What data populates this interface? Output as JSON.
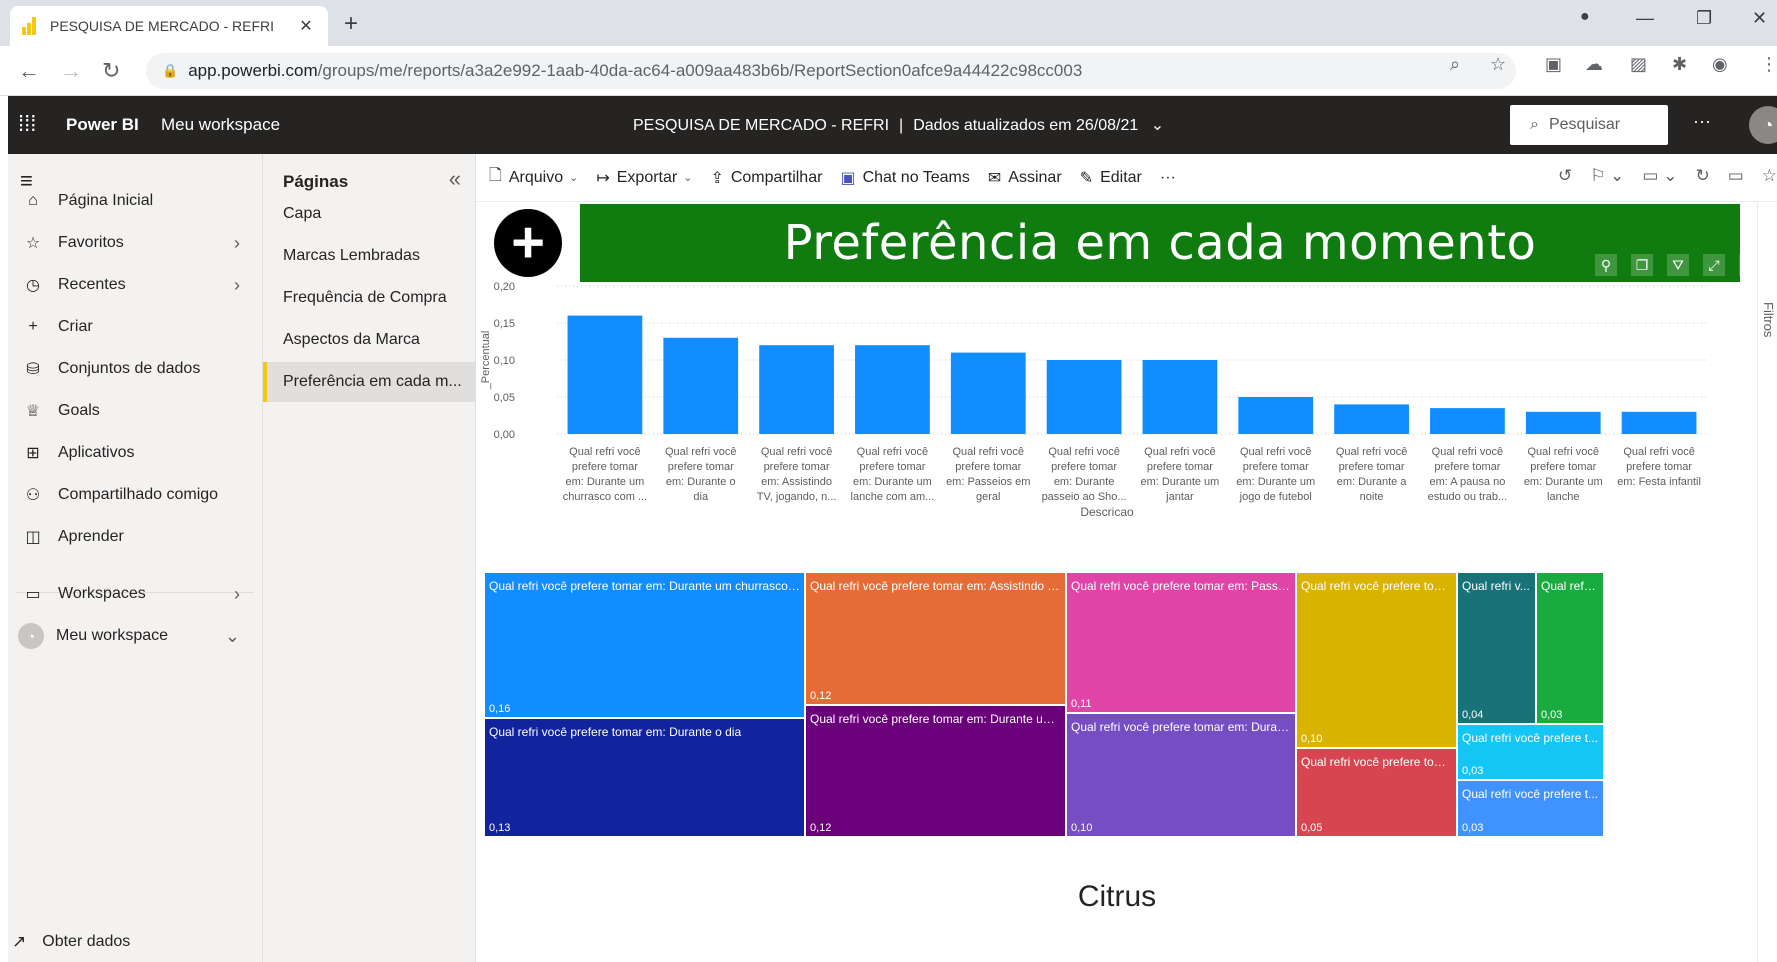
{
  "browser": {
    "tab_title": "PESQUISA DE MERCADO - REFRI",
    "tab_close": "✕",
    "new_tab": "+",
    "url_host": "app.powerbi.com",
    "url_path": "/groups/me/reports/a3a2e992-1aab-40da-ac64-a009aa483b6b/ReportSection0afce9a44422c98cc003",
    "window_controls": [
      "—",
      "❐",
      "✕"
    ]
  },
  "header": {
    "brand": "Power BI",
    "workspace": "Meu workspace",
    "report_title": "PESQUISA DE MERCADO - REFRI",
    "separator": "|",
    "updated": "Dados atualizados em 26/08/21",
    "search_placeholder": "Pesquisar",
    "more": "···"
  },
  "leftnav": {
    "items": [
      {
        "label": "Página Inicial",
        "icon": "home-icon"
      },
      {
        "label": "Favoritos",
        "icon": "star-icon"
      },
      {
        "label": "Recentes",
        "icon": "clock-icon"
      },
      {
        "label": "Criar",
        "icon": "plus-icon"
      },
      {
        "label": "Conjuntos de dados",
        "icon": "database-icon"
      },
      {
        "label": "Goals",
        "icon": "trophy-icon"
      },
      {
        "label": "Aplicativos",
        "icon": "apps-icon"
      },
      {
        "label": "Compartilhado comigo",
        "icon": "shared-icon"
      },
      {
        "label": "Aprender",
        "icon": "book-icon"
      }
    ],
    "workspaces": "Workspaces",
    "my_workspace": "Meu workspace",
    "get_data": "Obter dados"
  },
  "pages": {
    "heading": "Páginas",
    "items": [
      "Capa",
      "Marcas Lembradas",
      "Frequência de Compra",
      "Aspectos da Marca",
      "Preferência em cada m..."
    ],
    "active_index": 4
  },
  "actions": {
    "file": "Arquivo",
    "export": "Exportar",
    "share": "Compartilhar",
    "teams": "Chat no Teams",
    "subscribe": "Assinar",
    "edit": "Editar",
    "more": "···"
  },
  "report": {
    "banner_title": "Preferência em cada momento",
    "treemap_footer": "Citrus"
  },
  "filters": {
    "label": "Filtros"
  },
  "chart_data": {
    "type": "bar",
    "xlabel": "Descricao",
    "ylabel": "_Percentual",
    "ylim": [
      0,
      0.2
    ],
    "yticks": [
      "0,20",
      "0,15",
      "0,10",
      "0,05",
      "0,00"
    ],
    "grid": true,
    "categories": [
      [
        "Qual refri você",
        "prefere tomar",
        "em: Durante um",
        "churrasco com ..."
      ],
      [
        "Qual refri você",
        "prefere tomar",
        "em: Durante o",
        "dia"
      ],
      [
        "Qual refri você",
        "prefere tomar",
        "em: Assistindo",
        "TV, jogando, n..."
      ],
      [
        "Qual refri você",
        "prefere tomar",
        "em: Durante um",
        "lanche com am..."
      ],
      [
        "Qual refri você",
        "prefere tomar",
        "em: Passeios em",
        "geral"
      ],
      [
        "Qual refri você",
        "prefere tomar",
        "em: Durante",
        "passeio ao Sho..."
      ],
      [
        "Qual refri você",
        "prefere tomar",
        "em: Durante um",
        "jantar"
      ],
      [
        "Qual refri você",
        "prefere tomar",
        "em: Durante um",
        "jogo de futebol"
      ],
      [
        "Qual refri você",
        "prefere tomar",
        "em: Durante a",
        "noite"
      ],
      [
        "Qual refri você",
        "prefere tomar",
        "em: A pausa no",
        "estudo ou trab..."
      ],
      [
        "Qual refri você",
        "prefere tomar",
        "em: Durante um",
        "lanche"
      ],
      [
        "Qual refri você",
        "prefere tomar",
        "em: Festa infantil",
        ""
      ]
    ],
    "values": [
      0.16,
      0.13,
      0.12,
      0.12,
      0.11,
      0.1,
      0.1,
      0.05,
      0.04,
      0.035,
      0.03,
      0.03
    ],
    "bar_color": "#118dff"
  },
  "treemap": [
    {
      "label": "Qual refri você prefere tomar em: Durante um churrasco c...",
      "value": "0,16",
      "color": "#118dff"
    },
    {
      "label": "Qual refri você prefere tomar em: Durante o dia",
      "value": "0,13",
      "color": "#12239e"
    },
    {
      "label": "Qual refri você prefere tomar em: Assistindo T...",
      "value": "0,12",
      "color": "#e66c37"
    },
    {
      "label": "Qual refri você prefere tomar em: Durante um...",
      "value": "0,12",
      "color": "#6b007b"
    },
    {
      "label": "Qual refri você prefere tomar em: Passei...",
      "value": "0,11",
      "color": "#e044a7"
    },
    {
      "label": "Qual refri você prefere tomar em: Duran...",
      "value": "0,10",
      "color": "#744ec2"
    },
    {
      "label": "Qual refri você prefere tom...",
      "value": "0,10",
      "color": "#d9b300"
    },
    {
      "label": "Qual refri você prefere tom...",
      "value": "0,05",
      "color": "#d64550"
    },
    {
      "label": "Qual refri v...",
      "value": "0,04",
      "color": "#197278"
    },
    {
      "label": "Qual refri...",
      "value": "0,03",
      "color": "#1aab40"
    },
    {
      "label": "Qual refri você prefere t...",
      "value": "0,03",
      "color": "#15c6f4"
    },
    {
      "label": "Qual refri você prefere t...",
      "value": "0,03",
      "color": "#4092ff"
    }
  ]
}
